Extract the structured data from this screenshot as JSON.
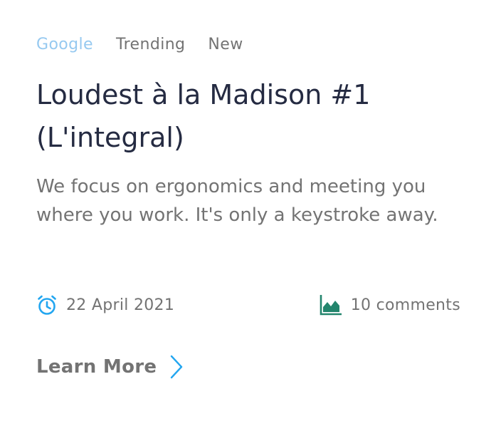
{
  "tags": [
    "Google",
    "Trending",
    "New"
  ],
  "active_tag_color": "#96c9f0",
  "title": "Loudest à la Madison #1 (L'integral)",
  "description": "We focus on ergonomics and meeting you where you work. It's only a keystroke away.",
  "meta": {
    "date_icon": "alarm-clock-icon",
    "date": "22 April 2021",
    "comments_icon": "area-chart-icon",
    "comments": "10 comments"
  },
  "cta": {
    "label": "Learn More",
    "icon": "chevron-right-icon"
  },
  "colors": {
    "title": "#252b42",
    "text": "#737373",
    "clock_icon": "#23a6f0",
    "chart_icon": "#23856d"
  }
}
